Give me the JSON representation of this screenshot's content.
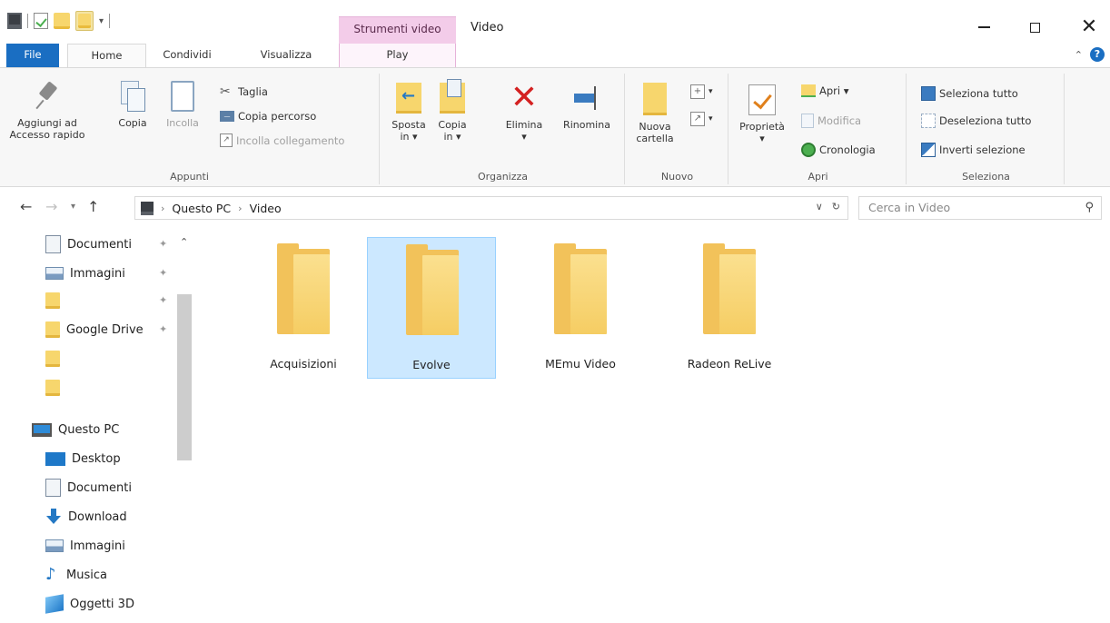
{
  "window": {
    "title": "Video",
    "context_tab_group": "Strumenti video"
  },
  "tabs": {
    "file": "File",
    "home": "Home",
    "condividi": "Condividi",
    "visualizza": "Visualizza",
    "play": "Play"
  },
  "ribbon": {
    "appunti": {
      "label": "Appunti",
      "pin": "Aggiungi ad Accesso rapido",
      "copy": "Copia",
      "paste": "Incolla",
      "cut": "Taglia",
      "copy_path": "Copia percorso",
      "paste_shortcut": "Incolla collegamento"
    },
    "organizza": {
      "label": "Organizza",
      "move": "Sposta in ▾",
      "copy_to": "Copia in ▾",
      "delete": "Elimina",
      "delete_arrow": "▾",
      "rename": "Rinomina"
    },
    "nuovo": {
      "label": "Nuovo",
      "new_folder": "Nuova cartella"
    },
    "apri": {
      "label": "Apri",
      "properties": "Proprietà",
      "properties_arrow": "▾",
      "open": "Apri ▾",
      "edit": "Modifica",
      "history": "Cronologia"
    },
    "seleziona": {
      "label": "Seleziona",
      "select_all": "Seleziona tutto",
      "select_none": "Deseleziona tutto",
      "invert": "Inverti selezione"
    }
  },
  "address": {
    "path": [
      "Questo PC",
      "Video"
    ],
    "search_placeholder": "Cerca in Video"
  },
  "navigation": {
    "quick_access": [
      {
        "label": "Documenti",
        "icon": "documents-icon",
        "pinned": true
      },
      {
        "label": "Immagini",
        "icon": "pictures-icon",
        "pinned": true
      },
      {
        "label": "",
        "icon": "folder-icon",
        "pinned": true
      },
      {
        "label": "Google Drive",
        "icon": "folder-icon",
        "pinned": true
      },
      {
        "label": "",
        "icon": "folder-icon",
        "pinned": false
      },
      {
        "label": "",
        "icon": "folder-icon",
        "pinned": false
      }
    ],
    "this_pc": "Questo PC",
    "this_pc_items": [
      {
        "label": "Desktop",
        "icon": "desktop-icon"
      },
      {
        "label": "Documenti",
        "icon": "documents-icon"
      },
      {
        "label": "Download",
        "icon": "download-icon"
      },
      {
        "label": "Immagini",
        "icon": "pictures-icon"
      },
      {
        "label": "Musica",
        "icon": "music-icon"
      },
      {
        "label": "Oggetti 3D",
        "icon": "3d-objects-icon"
      }
    ]
  },
  "content": {
    "folders": [
      {
        "name": "Acquisizioni",
        "selected": false
      },
      {
        "name": "Evolve",
        "selected": true
      },
      {
        "name": "MEmu Video",
        "selected": false
      },
      {
        "name": "Radeon ReLive",
        "selected": false
      }
    ]
  },
  "colors": {
    "accent": "#1a6ec2",
    "context_tab": "#f3cce9",
    "selection": "#cce8ff",
    "folder": "#f7d66d"
  }
}
